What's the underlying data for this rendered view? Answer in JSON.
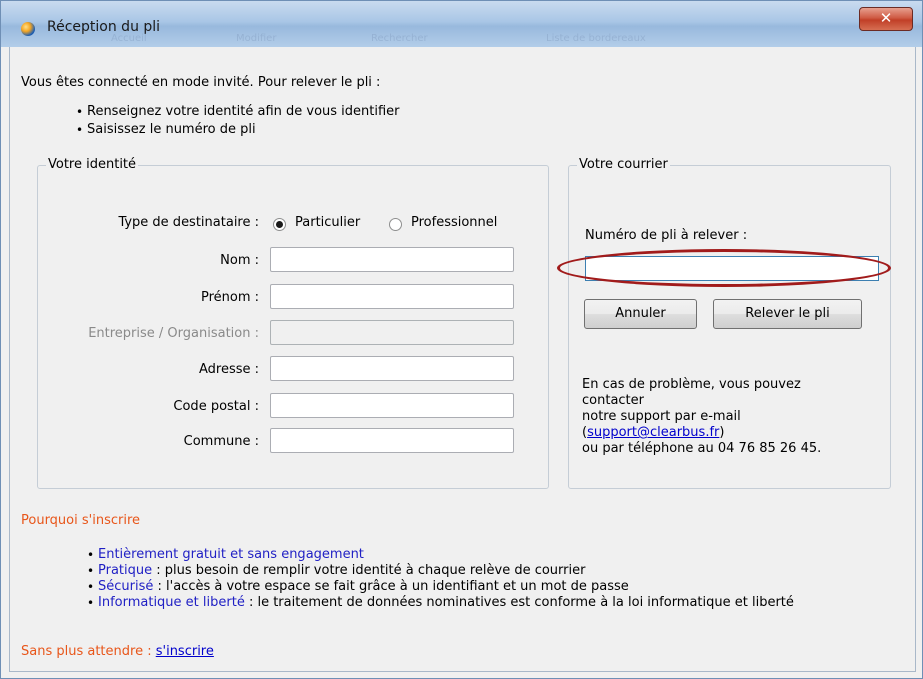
{
  "window": {
    "title": "Réception du pli",
    "close_glyph": "✕",
    "background_tabs": [
      "Accueil",
      "Modifier",
      "Rechercher",
      "Liste de bordereaux"
    ]
  },
  "intro": {
    "text": "Vous êtes connecté en mode invité. Pour relever le pli :",
    "bullets": [
      "Renseignez votre identité afin de vous identifier",
      "Saisissez le numéro de pli"
    ]
  },
  "identite": {
    "legend": "Votre identité",
    "type_label": "Type de destinataire :",
    "radio_options": [
      "Particulier",
      "Professionnel"
    ],
    "selected": "Particulier",
    "fields": [
      {
        "label": "Nom :",
        "value": "",
        "disabled": false
      },
      {
        "label": "Prénom :",
        "value": "",
        "disabled": false
      },
      {
        "label": "Entreprise / Organisation :",
        "value": "",
        "disabled": true
      },
      {
        "label": "Adresse :",
        "value": "",
        "disabled": false
      },
      {
        "label": "Code postal :",
        "value": "",
        "disabled": false
      },
      {
        "label": "Commune :",
        "value": "",
        "disabled": false
      }
    ]
  },
  "courrier": {
    "legend": "Votre courrier",
    "pli_label": "Numéro de pli à relever :",
    "pli_value": "",
    "cancel_label": "Annuler",
    "submit_label": "Relever le pli",
    "help_line1": "En cas de problème, vous pouvez",
    "help_line2": "contacter",
    "help_line3": "notre support par e-mail",
    "help_email_open": "(",
    "help_email": "support@clearbus.fr",
    "help_email_close": ")",
    "help_line5": "ou par téléphone au 04 76 85 26 45."
  },
  "pourquoi": {
    "title": "Pourquoi s'inscrire",
    "items": [
      {
        "head": "Entièrement gratuit et sans engagement",
        "rest": ""
      },
      {
        "head": "Pratique",
        "rest": " : plus besoin de remplir votre identité à chaque relève de courrier"
      },
      {
        "head": "Sécurisé",
        "rest": " : l'accès à votre espace se fait grâce à un identifiant et un mot de passe"
      },
      {
        "head": "Informatique et liberté",
        "rest": " : le traitement de données nominatives est conforme à la loi informatique et liberté"
      }
    ]
  },
  "footer": {
    "prefix": "Sans plus attendre : ",
    "link": "s'inscrire"
  },
  "colors": {
    "accent_orange": "#e8561a",
    "link_blue": "#0000cc",
    "highlight_red": "#a11b1b"
  }
}
